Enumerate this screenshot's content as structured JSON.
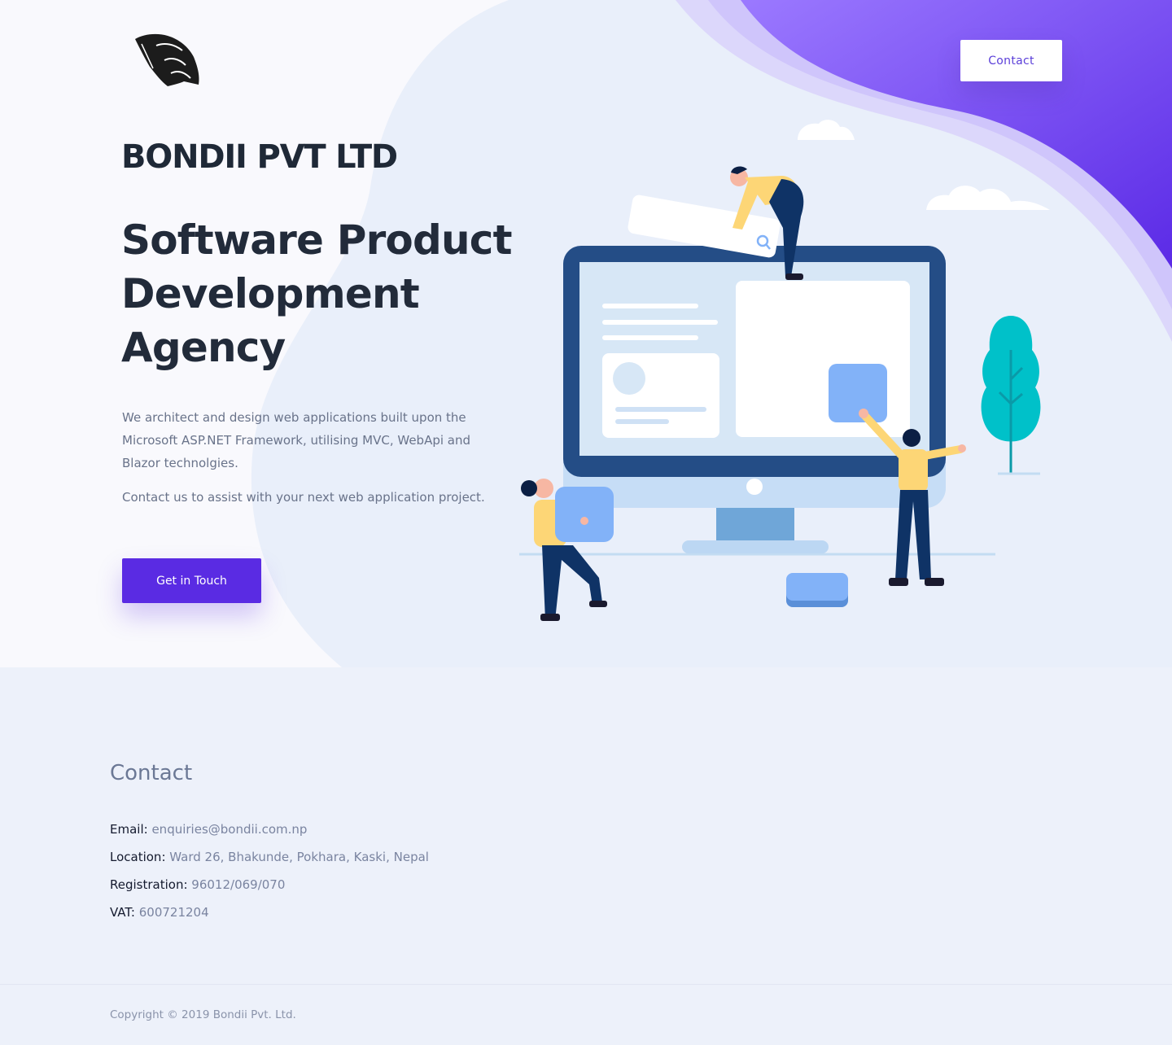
{
  "brand": {
    "logo_icon": "panther-head-logo"
  },
  "nav": {
    "contact_label": "Contact"
  },
  "hero": {
    "company_name": "BONDII PVT LTD",
    "headline_line1": "Software Product",
    "headline_line2": "Development",
    "headline_line3": "Agency",
    "description": "We architect and design web applications built upon the Microsoft ASP.NET Framework, utilising MVC, WebApi and Blazor technolgies.",
    "cta_text": "Contact us to assist with your next web application project.",
    "cta_button": "Get in Touch",
    "illustration_icon": "team-building-website-illustration"
  },
  "contact": {
    "title": "Contact",
    "items": [
      {
        "label": "Email:",
        "value": "enquiries@bondii.com.np"
      },
      {
        "label": "Location:",
        "value": "Ward 26, Bhakunde, Pokhara, Kaski, Nepal"
      },
      {
        "label": "Registration:",
        "value": "96012/069/070"
      },
      {
        "label": "VAT:",
        "value": "600721204"
      }
    ]
  },
  "footer": {
    "copyright": "Copyright © 2019 Bondii Pvt. Ltd."
  },
  "colors": {
    "accent": "#5a2be3",
    "heading": "#1f2937",
    "body_text": "#69738a",
    "section_bg": "#edf1fa",
    "teal": "#00c1c9",
    "yellow": "#fdd676"
  }
}
